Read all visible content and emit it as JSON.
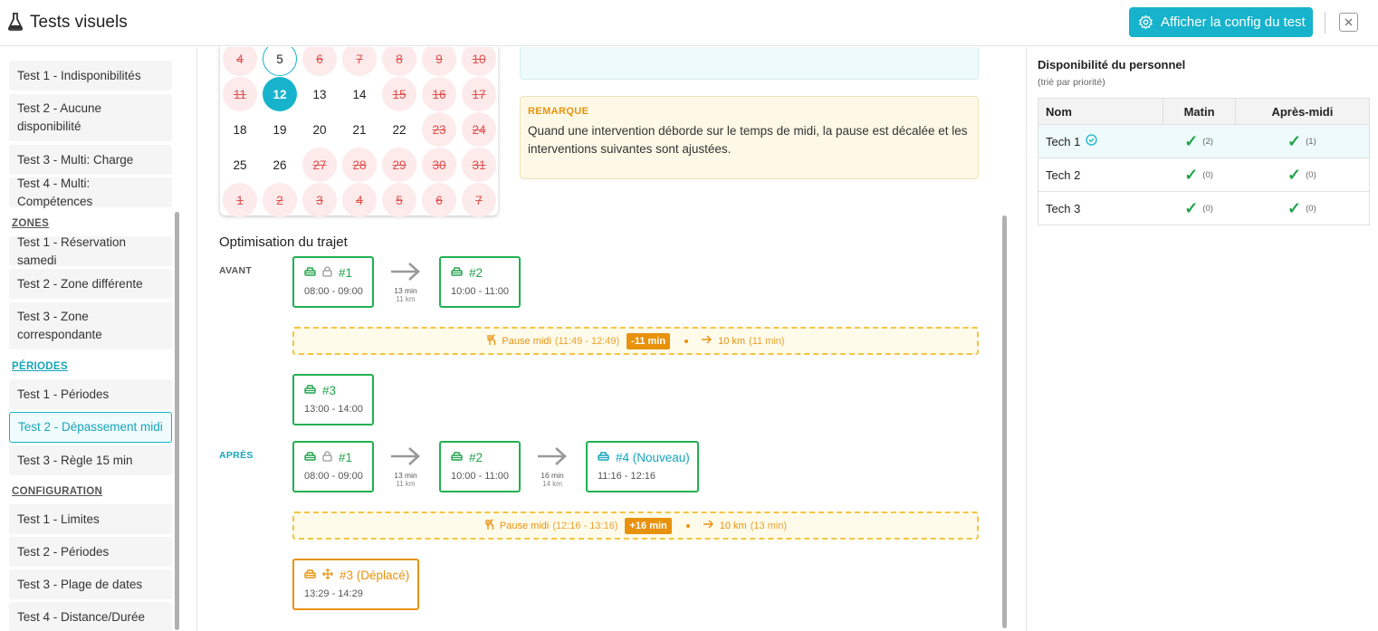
{
  "header": {
    "title": "Tests visuels",
    "config_button": "Afficher la config du test"
  },
  "sidebar": {
    "items_top": [
      "Test 1 - Indisponibilités",
      "Test 2 - Aucune disponibilité",
      "Test 3 - Multi: Charge",
      "Test 4 - Multi: Compétences"
    ],
    "zones_label": "ZONES",
    "zones": [
      "Test 1 - Réservation samedi",
      "Test 2 - Zone différente",
      "Test 3 - Zone correspondante"
    ],
    "periodes_label": "PÉRIODES",
    "periodes": [
      "Test 1 - Périodes",
      "Test 2 - Dépassement midi",
      "Test 3 - Règle 15 min"
    ],
    "config_label": "CONFIGURATION",
    "config": [
      "Test 1 - Limites",
      "Test 2 - Périodes",
      "Test 3 - Plage de dates",
      "Test 4 - Distance/Durée"
    ]
  },
  "calendar": {
    "rows": [
      [
        "4",
        "5",
        "6",
        "7",
        "8",
        "9",
        "10"
      ],
      [
        "11",
        "12",
        "13",
        "14",
        "15",
        "16",
        "17"
      ],
      [
        "18",
        "19",
        "20",
        "21",
        "22",
        "23",
        "24"
      ],
      [
        "25",
        "26",
        "27",
        "28",
        "29",
        "30",
        "31"
      ],
      [
        "1",
        "2",
        "3",
        "4",
        "5",
        "6",
        "7"
      ]
    ],
    "off": [
      [
        true,
        false,
        true,
        true,
        true,
        true,
        true
      ],
      [
        true,
        false,
        false,
        false,
        true,
        true,
        true
      ],
      [
        false,
        false,
        false,
        false,
        false,
        true,
        true
      ],
      [
        false,
        false,
        true,
        true,
        true,
        true,
        true
      ],
      [
        true,
        true,
        true,
        true,
        true,
        true,
        true
      ]
    ],
    "selected": "12"
  },
  "remarque": {
    "title": "REMARQUE",
    "text": "Quand une intervention déborde sur le temps de midi, la pause est décalée et les interventions suivantes sont ajustées."
  },
  "optimisation": {
    "title": "Optimisation du trajet",
    "avant_label": "AVANT",
    "apres_label": "APRÈS",
    "avant": {
      "c1": {
        "label": "#1",
        "time": "08:00 - 09:00"
      },
      "a1": {
        "dur": "13 min",
        "km": "11 km"
      },
      "c2": {
        "label": "#2",
        "time": "10:00 - 11:00"
      },
      "pause": {
        "text": "Pause midi",
        "range": "(11:49 - 12:49)",
        "badge": "-11 min",
        "dist": "10 km",
        "dist_time": "(11 min)"
      },
      "c3": {
        "label": "#3",
        "time": "13:00 - 14:00"
      }
    },
    "apres": {
      "c1": {
        "label": "#1",
        "time": "08:00 - 09:00"
      },
      "a1": {
        "dur": "13 min",
        "km": "11 km"
      },
      "c2": {
        "label": "#2",
        "time": "10:00 - 11:00"
      },
      "a2": {
        "dur": "16 min",
        "km": "14 km"
      },
      "c4": {
        "label": "#4 (Nouveau)",
        "time": "11:16 - 12:16"
      },
      "pause": {
        "text": "Pause midi",
        "range": "(12:16 - 13:16)",
        "badge": "+16 min",
        "dist": "10 km",
        "dist_time": "(13 min)"
      },
      "c3": {
        "label": "#3 (Déplacé)",
        "time": "13:29 - 14:29"
      }
    }
  },
  "personnel": {
    "title": "Disponibilité du personnel",
    "subtitle": "(trié par priorité)",
    "headers": {
      "name": "Nom",
      "matin": "Matin",
      "apres_midi": "Après-midi"
    },
    "rows": [
      {
        "name": "Tech 1",
        "matin": "(2)",
        "apres_midi": "(1)"
      },
      {
        "name": "Tech 2",
        "matin": "(0)",
        "apres_midi": "(0)"
      },
      {
        "name": "Tech 3",
        "matin": "(0)",
        "apres_midi": "(0)"
      }
    ]
  },
  "colors": {
    "accent": "#17b3cc",
    "green": "#22b052",
    "orange": "#e8920c"
  },
  "icons": {
    "flask": "flask-icon",
    "gear": "gear-icon",
    "close": "close-icon",
    "car": "car-icon",
    "lock": "lock-icon",
    "move": "move-icon",
    "utensils": "utensils-icon",
    "check": "check-icon",
    "check-circle": "check-circle-icon"
  }
}
